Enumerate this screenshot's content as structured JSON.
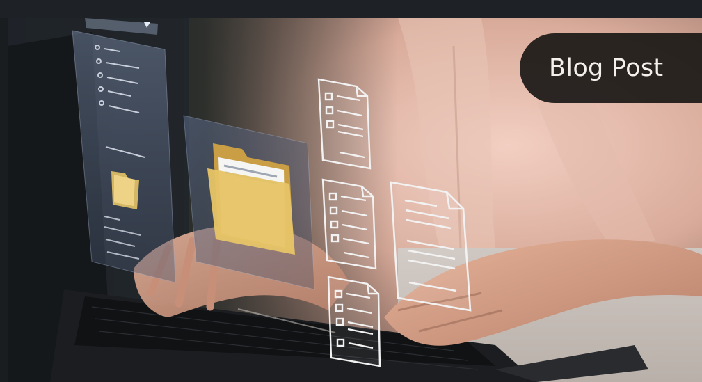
{
  "badge": {
    "label": "Blog Post"
  },
  "colors": {
    "badge_background": "#1a1816",
    "badge_text": "#f4f1ec",
    "folder_yellow": "#e6c467",
    "hologram_line": "#f2f2f2"
  },
  "icons": [
    "folder-icon",
    "document-icon",
    "checklist-icon"
  ]
}
